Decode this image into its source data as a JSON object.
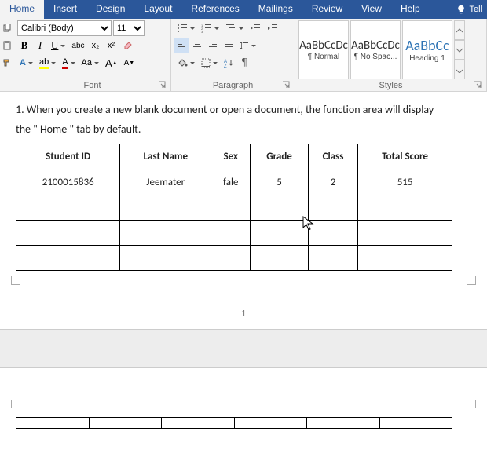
{
  "tabs": {
    "home": "Home",
    "insert": "Insert",
    "design": "Design",
    "layout": "Layout",
    "references": "References",
    "mailings": "Mailings",
    "review": "Review",
    "view": "View",
    "help": "Help",
    "tell": "Tell"
  },
  "font": {
    "name_value": "Calibri (Body)",
    "size_value": "11",
    "group_label": "Font",
    "bold": "B",
    "italic": "I",
    "underline": "U",
    "strike": "abc",
    "sub": "x₂",
    "sup": "x²",
    "fontcolor_letter": "A",
    "highlight_letter": "ab",
    "textfx_letter": "A",
    "case": "Aa",
    "grow": "A",
    "shrink": "A"
  },
  "paragraph": {
    "group_label": "Paragraph"
  },
  "styles": {
    "group_label": "Styles",
    "preview": "AaBbCcDc",
    "preview_h1": "AaBbCc",
    "normal": "¶ Normal",
    "nospacing": "¶ No Spac...",
    "heading1": "Heading 1"
  },
  "doc": {
    "paragraph1": "1. When you create a new blank document or open a document, the function area will display",
    "paragraph2": "the \" Home \" tab by default.",
    "page_number": "1"
  },
  "table": {
    "headers": [
      "Student ID",
      "Last Name",
      "Sex",
      "Grade",
      "Class",
      "Total Score"
    ],
    "rows": [
      [
        "2100015836",
        "Jeemater",
        "fale",
        "5",
        "2",
        "515"
      ],
      [
        "",
        "",
        "",
        "",
        "",
        ""
      ],
      [
        "",
        "",
        "",
        "",
        "",
        ""
      ],
      [
        "",
        "",
        "",
        "",
        "",
        ""
      ]
    ]
  }
}
